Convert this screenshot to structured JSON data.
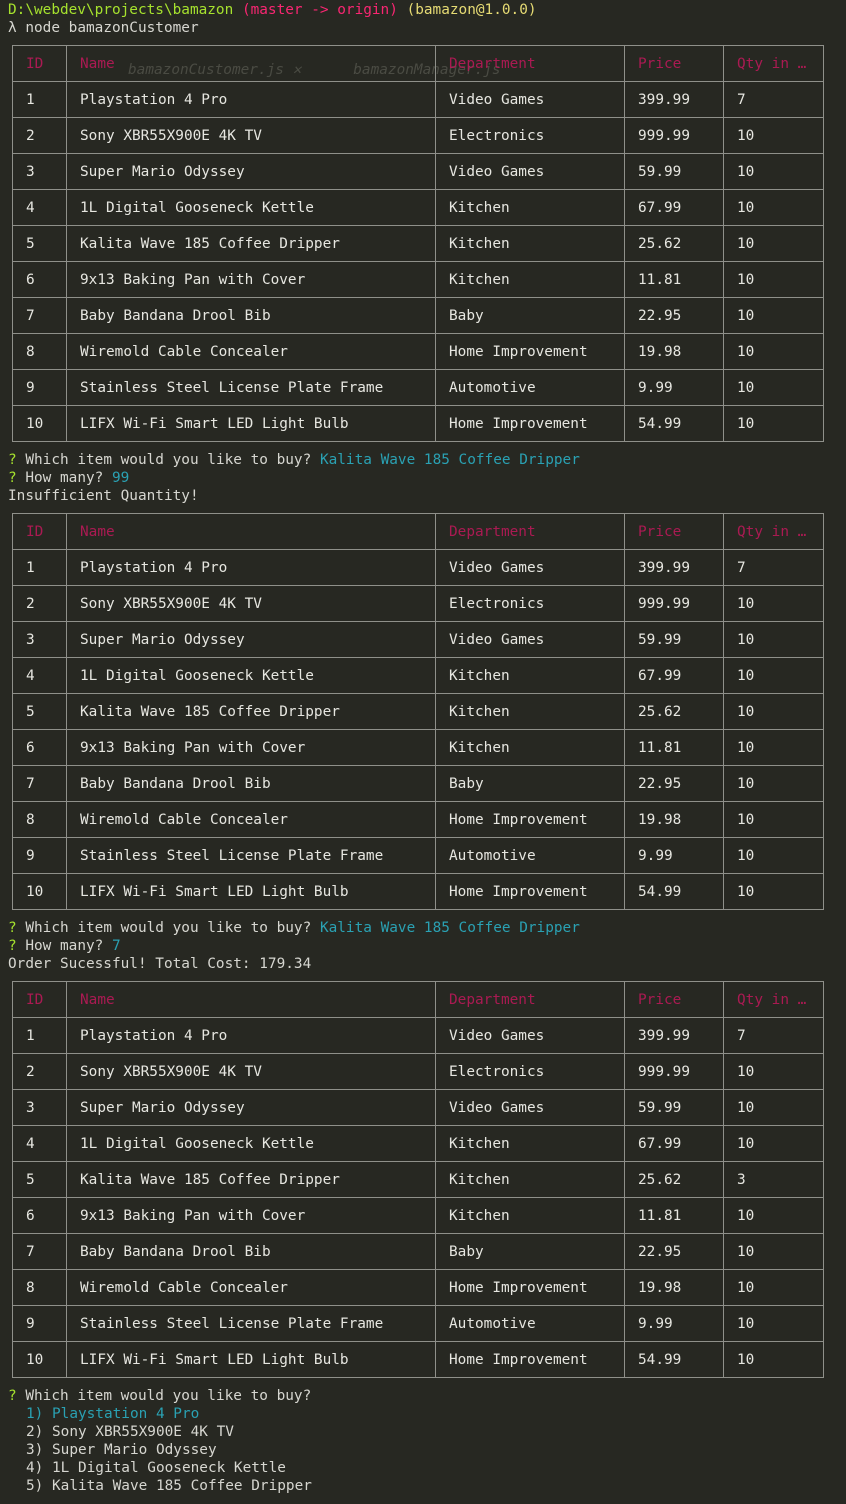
{
  "prompt": {
    "path": "D:\\webdev\\projects\\bamazon",
    "branch": "(master -> origin)",
    "package": "(bamazon@1.0.0)",
    "symbol": "λ",
    "command": "node bamazonCustomer"
  },
  "table": {
    "headers": [
      "ID",
      "Name",
      "Department",
      "Price",
      "Qty in …"
    ]
  },
  "tables": [
    {
      "rows": [
        [
          "1",
          "Playstation 4 Pro",
          "Video Games",
          "399.99",
          "7"
        ],
        [
          "2",
          "Sony XBR55X900E 4K TV",
          "Electronics",
          "999.99",
          "10"
        ],
        [
          "3",
          "Super Mario Odyssey",
          "Video Games",
          "59.99",
          "10"
        ],
        [
          "4",
          "1L Digital Gooseneck Kettle",
          "Kitchen",
          "67.99",
          "10"
        ],
        [
          "5",
          "Kalita Wave 185 Coffee Dripper",
          "Kitchen",
          "25.62",
          "10"
        ],
        [
          "6",
          "9x13 Baking Pan with Cover",
          "Kitchen",
          "11.81",
          "10"
        ],
        [
          "7",
          "Baby Bandana Drool Bib",
          "Baby",
          "22.95",
          "10"
        ],
        [
          "8",
          "Wiremold Cable Concealer",
          "Home Improvement",
          "19.98",
          "10"
        ],
        [
          "9",
          "Stainless Steel License Plate Frame",
          "Automotive",
          "9.99",
          "10"
        ],
        [
          "10",
          "LIFX Wi-Fi Smart LED Light Bulb",
          "Home Improvement",
          "54.99",
          "10"
        ]
      ]
    },
    {
      "rows": [
        [
          "1",
          "Playstation 4 Pro",
          "Video Games",
          "399.99",
          "7"
        ],
        [
          "2",
          "Sony XBR55X900E 4K TV",
          "Electronics",
          "999.99",
          "10"
        ],
        [
          "3",
          "Super Mario Odyssey",
          "Video Games",
          "59.99",
          "10"
        ],
        [
          "4",
          "1L Digital Gooseneck Kettle",
          "Kitchen",
          "67.99",
          "10"
        ],
        [
          "5",
          "Kalita Wave 185 Coffee Dripper",
          "Kitchen",
          "25.62",
          "10"
        ],
        [
          "6",
          "9x13 Baking Pan with Cover",
          "Kitchen",
          "11.81",
          "10"
        ],
        [
          "7",
          "Baby Bandana Drool Bib",
          "Baby",
          "22.95",
          "10"
        ],
        [
          "8",
          "Wiremold Cable Concealer",
          "Home Improvement",
          "19.98",
          "10"
        ],
        [
          "9",
          "Stainless Steel License Plate Frame",
          "Automotive",
          "9.99",
          "10"
        ],
        [
          "10",
          "LIFX Wi-Fi Smart LED Light Bulb",
          "Home Improvement",
          "54.99",
          "10"
        ]
      ]
    },
    {
      "rows": [
        [
          "1",
          "Playstation 4 Pro",
          "Video Games",
          "399.99",
          "7"
        ],
        [
          "2",
          "Sony XBR55X900E 4K TV",
          "Electronics",
          "999.99",
          "10"
        ],
        [
          "3",
          "Super Mario Odyssey",
          "Video Games",
          "59.99",
          "10"
        ],
        [
          "4",
          "1L Digital Gooseneck Kettle",
          "Kitchen",
          "67.99",
          "10"
        ],
        [
          "5",
          "Kalita Wave 185 Coffee Dripper",
          "Kitchen",
          "25.62",
          "3"
        ],
        [
          "6",
          "9x13 Baking Pan with Cover",
          "Kitchen",
          "11.81",
          "10"
        ],
        [
          "7",
          "Baby Bandana Drool Bib",
          "Baby",
          "22.95",
          "10"
        ],
        [
          "8",
          "Wiremold Cable Concealer",
          "Home Improvement",
          "19.98",
          "10"
        ],
        [
          "9",
          "Stainless Steel License Plate Frame",
          "Automotive",
          "9.99",
          "10"
        ],
        [
          "10",
          "LIFX Wi-Fi Smart LED Light Bulb",
          "Home Improvement",
          "54.99",
          "10"
        ]
      ]
    }
  ],
  "session1": {
    "q_mark": "?",
    "question": "Which item would you like to buy?",
    "answer": "Kalita Wave 185 Coffee Dripper",
    "qty_question": "How many?",
    "qty_answer": "99",
    "result": "Insufficient Quantity!"
  },
  "session2": {
    "q_mark": "?",
    "question": "Which item would you like to buy?",
    "answer": "Kalita Wave 185 Coffee Dripper",
    "qty_question": "How many?",
    "qty_answer": "7",
    "result": "Order Sucessful! Total Cost: 179.34"
  },
  "session3": {
    "q_mark": "?",
    "question": "Which item would you like to buy?",
    "choices": [
      "1) Playstation 4 Pro",
      "2) Sony XBR55X900E 4K TV",
      "3) Super Mario Odyssey",
      "4) 1L Digital Gooseneck Kettle",
      "5) Kalita Wave 185 Coffee Dripper"
    ]
  },
  "colors": {
    "background": "#272822",
    "path": "#a6e22e",
    "branch": "#f92672",
    "package": "#e6db74",
    "answer": "#2aa1b3",
    "header": "#c2185b",
    "border": "#8f908a"
  }
}
